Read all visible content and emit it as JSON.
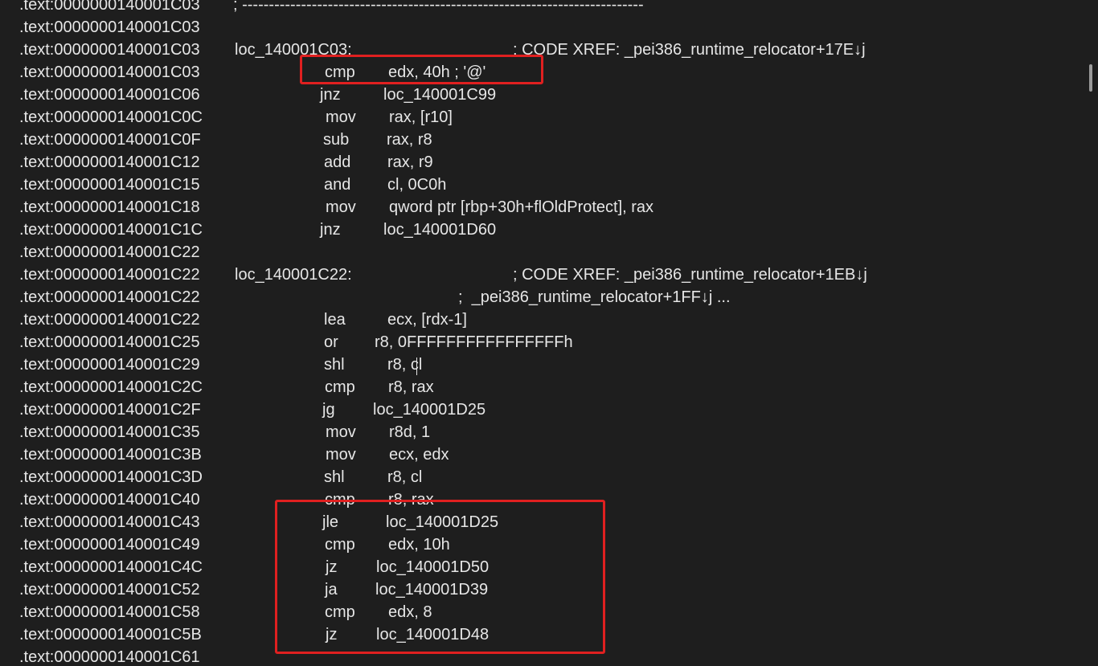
{
  "lines": [
    {
      "addr": ".text:0000000140001C03",
      "label": "",
      "mnemonic": "",
      "operands": "",
      "comment": "; ---------------------------------------------------------------------------"
    },
    {
      "addr": ".text:0000000140001C03",
      "label": "",
      "mnemonic": "",
      "operands": "",
      "comment": ""
    },
    {
      "addr": ".text:0000000140001C03",
      "label": "loc_140001C03:",
      "mnemonic": "",
      "operands": "",
      "comment": "; CODE XREF: _pei386_runtime_relocator+17E↓j"
    },
    {
      "addr": ".text:0000000140001C03",
      "label": "",
      "mnemonic": "cmp",
      "operands": "edx, 40h ; '@'",
      "comment": ""
    },
    {
      "addr": ".text:0000000140001C06",
      "label": "",
      "mnemonic": "jnz",
      "operands": "loc_140001C99",
      "comment": ""
    },
    {
      "addr": ".text:0000000140001C0C",
      "label": "",
      "mnemonic": "mov",
      "operands": "rax, [r10]",
      "comment": ""
    },
    {
      "addr": ".text:0000000140001C0F",
      "label": "",
      "mnemonic": "sub",
      "operands": "rax, r8",
      "comment": ""
    },
    {
      "addr": ".text:0000000140001C12",
      "label": "",
      "mnemonic": "add",
      "operands": "rax, r9",
      "comment": ""
    },
    {
      "addr": ".text:0000000140001C15",
      "label": "",
      "mnemonic": "and",
      "operands": "cl, 0C0h",
      "comment": ""
    },
    {
      "addr": ".text:0000000140001C18",
      "label": "",
      "mnemonic": "mov",
      "operands": "qword ptr [rbp+30h+flOldProtect], rax",
      "comment": ""
    },
    {
      "addr": ".text:0000000140001C1C",
      "label": "",
      "mnemonic": "jnz",
      "operands": "loc_140001D60",
      "comment": ""
    },
    {
      "addr": ".text:0000000140001C22",
      "label": "",
      "mnemonic": "",
      "operands": "",
      "comment": ""
    },
    {
      "addr": ".text:0000000140001C22",
      "label": "loc_140001C22:",
      "mnemonic": "",
      "operands": "",
      "comment": "; CODE XREF: _pei386_runtime_relocator+1EB↓j"
    },
    {
      "addr": ".text:0000000140001C22",
      "label": "",
      "mnemonic": "",
      "operands": "",
      "comment": ";  _pei386_runtime_relocator+1FF↓j ..."
    },
    {
      "addr": ".text:0000000140001C22",
      "label": "",
      "mnemonic": "lea",
      "operands": "ecx, [rdx-1]",
      "comment": ""
    },
    {
      "addr": ".text:0000000140001C25",
      "label": "",
      "mnemonic": "or",
      "operands": "r8, 0FFFFFFFFFFFFFFFFh",
      "comment": ""
    },
    {
      "addr": ".text:0000000140001C29",
      "label": "",
      "mnemonic": "shl",
      "operands": "r8, cl",
      "comment": ""
    },
    {
      "addr": ".text:0000000140001C2C",
      "label": "",
      "mnemonic": "cmp",
      "operands": "r8, rax",
      "comment": ""
    },
    {
      "addr": ".text:0000000140001C2F",
      "label": "",
      "mnemonic": "jg",
      "operands": "loc_140001D25",
      "comment": ""
    },
    {
      "addr": ".text:0000000140001C35",
      "label": "",
      "mnemonic": "mov",
      "operands": "r8d, 1",
      "comment": ""
    },
    {
      "addr": ".text:0000000140001C3B",
      "label": "",
      "mnemonic": "mov",
      "operands": "ecx, edx",
      "comment": ""
    },
    {
      "addr": ".text:0000000140001C3D",
      "label": "",
      "mnemonic": "shl",
      "operands": "r8, cl",
      "comment": ""
    },
    {
      "addr": ".text:0000000140001C40",
      "label": "",
      "mnemonic": "cmp",
      "operands": "r8, rax",
      "comment": ""
    },
    {
      "addr": ".text:0000000140001C43",
      "label": "",
      "mnemonic": "jle",
      "operands": "loc_140001D25",
      "comment": ""
    },
    {
      "addr": ".text:0000000140001C49",
      "label": "",
      "mnemonic": "cmp",
      "operands": "edx, 10h",
      "comment": ""
    },
    {
      "addr": ".text:0000000140001C4C",
      "label": "",
      "mnemonic": "jz",
      "operands": "loc_140001D50",
      "comment": ""
    },
    {
      "addr": ".text:0000000140001C52",
      "label": "",
      "mnemonic": "ja",
      "operands": "loc_140001D39",
      "comment": ""
    },
    {
      "addr": ".text:0000000140001C58",
      "label": "",
      "mnemonic": "cmp",
      "operands": "edx, 8",
      "comment": ""
    },
    {
      "addr": ".text:0000000140001C5B",
      "label": "",
      "mnemonic": "jz",
      "operands": "loc_140001D48",
      "comment": ""
    },
    {
      "addr": ".text:0000000140001C61",
      "label": "",
      "mnemonic": "",
      "operands": "",
      "comment": ""
    }
  ],
  "colors": {
    "background": "#1e1e1e",
    "text": "#e6e6e6",
    "highlight_border": "#e02020",
    "scrollbar_thumb": "#9a9a9a"
  }
}
